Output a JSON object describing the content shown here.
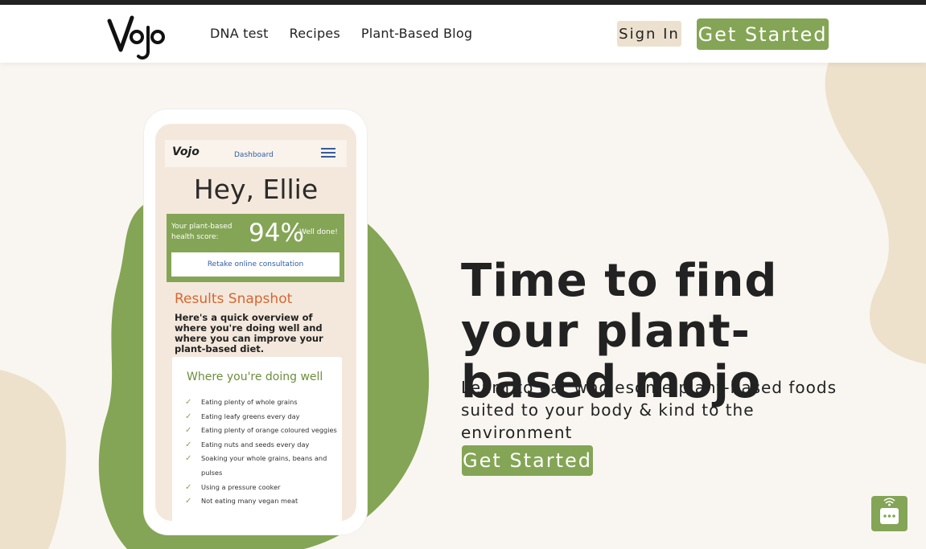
{
  "colors": {
    "brand_green": "#84a555",
    "cream": "#f9f6f1",
    "beige": "#ede1cc",
    "accent_orange": "#d8662f"
  },
  "header": {
    "logo_text": "Vojo",
    "nav": [
      "DNA test",
      "Recipes",
      "Plant-Based Blog"
    ],
    "sign_in_label": "Sign In",
    "get_started_label": "Get Started"
  },
  "phone": {
    "logo_text": "Vojo",
    "dashboard_label": "Dashboard",
    "menu_icon": "hamburger-icon",
    "greeting": "Hey, Ellie",
    "score_label": "Your plant-based health score:",
    "score_value": "94%",
    "score_comment": "Well done!",
    "retake_label": "Retake online consultation",
    "results_title": "Results Snapshot",
    "results_desc": "Here's a quick overview of where you're doing well and where you can improve your plant-based diet.",
    "well_title": "Where you're doing well",
    "well_items": [
      "Eating plenty of whole grains",
      "Eating leafy greens every day",
      "Eating plenty of orange coloured veggies",
      "Eating nuts and seeds every day",
      "Soaking your whole grains, beans and pulses",
      "Using a pressure cooker",
      "Not eating many vegan meat"
    ]
  },
  "hero": {
    "title": "Time to find your plant-based mojo",
    "subtitle": "Learn to eat wholesome plant-based foods suited to your body & kind to the environment",
    "cta_label": "Get Started"
  },
  "chat": {
    "icon": "chat-bubble-icon"
  }
}
